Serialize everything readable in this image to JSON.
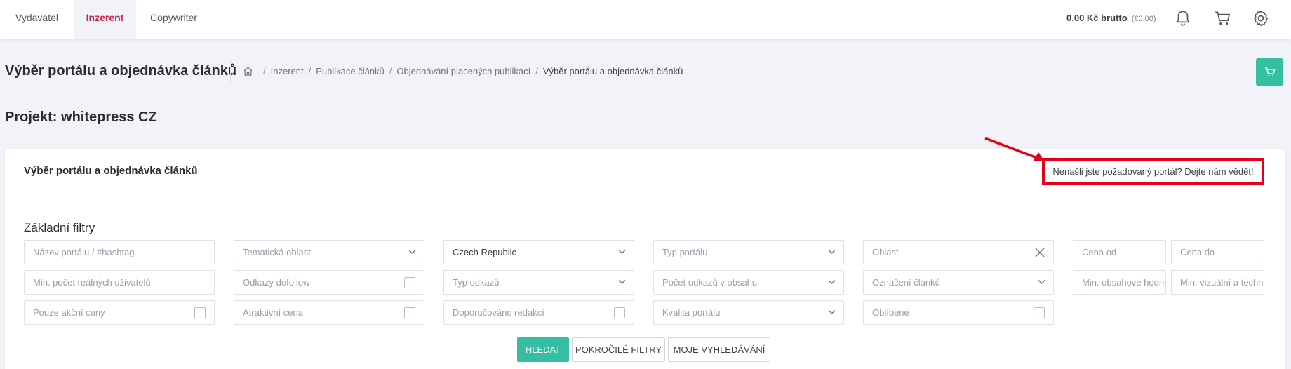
{
  "topbar": {
    "tabs": [
      "Vydavatel",
      "Inzerent",
      "Copywriter"
    ],
    "active_tab": "Inzerent",
    "balance": "0,00 Kč brutto",
    "balance_eur": "(€0,00)",
    "icons": [
      "bell-icon",
      "cart-icon",
      "gear-icon"
    ]
  },
  "header": {
    "title": "Výběr portálu a objednávka článků",
    "breadcrumb": [
      "Inzerent",
      "Publikace článků",
      "Objednávání placených publikací",
      "Výběr portálu a objednávka článků"
    ],
    "breadcrumb_separator": "/",
    "home_icon": "home-icon",
    "cart_button_icon": "cart-icon"
  },
  "project": {
    "label": "Projekt: whitepress CZ"
  },
  "card": {
    "title": "Výběr portálu a objednávka článků",
    "not_found_link": "Nenašli jste požadovaný portál? Dejte nám vědět!",
    "section_title": "Základní filtry"
  },
  "filters": {
    "row1": {
      "portal_name": "Název portálu / #hashtag",
      "topic_area": "Tematická oblast",
      "country": "Czech Republic",
      "portal_type": "Typ portálu",
      "region": "Oblast",
      "price_from": "Cena od",
      "price_to": "Cena do"
    },
    "row2": {
      "min_users": "Min. počet reálných uživatelů",
      "dofollow": "Odkazy dofollow",
      "link_type": "Typ odkazů",
      "link_count": "Počet odkazů v obsahu",
      "article_label": "Označení článků",
      "min_content": "Min. obsahové hodnocení",
      "min_visual": "Min. vizuální a technické hodnocení"
    },
    "row3": {
      "promo_only": "Pouze akční ceny",
      "attractive_price": "Atraktivní cena",
      "editor_recommended": "Doporučováno redakcí",
      "portal_quality": "Kvalita portálu",
      "favorites": "Oblíbené"
    }
  },
  "actions": {
    "search": "HLEDAT",
    "advanced": "POKROČILÉ FILTRY",
    "my_searches": "MOJE VYHLEDÁVÁNÍ"
  },
  "colors": {
    "accent": "#34bfa3",
    "active_tab": "#c0244a",
    "highlight": "#e4001b"
  }
}
